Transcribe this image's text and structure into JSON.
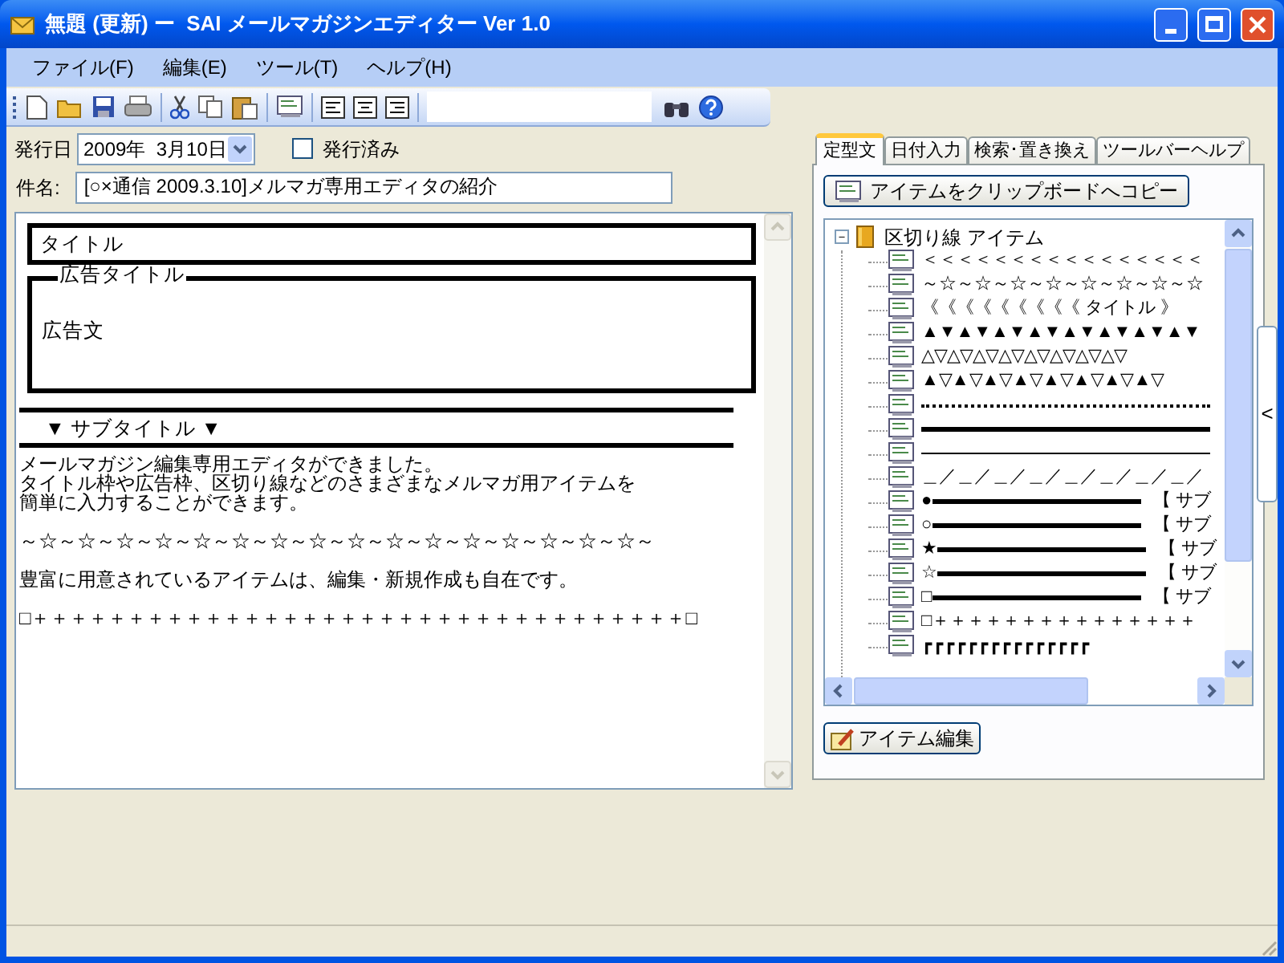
{
  "window": {
    "title": "無題 (更新) ー  SAI メールマガジンエディター Ver 1.0"
  },
  "menu": [
    "ファイル(F)",
    "編集(E)",
    "ツール(T)",
    "ヘルプ(H)"
  ],
  "form": {
    "date_label": "発行日",
    "date": "2009年  3月10日",
    "published": {
      "label": "発行済み",
      "checked": false
    },
    "subject_label": "件名:",
    "subject": "[○×通信 2009.3.10]メルマガ専用エディタの紹介"
  },
  "editor": [
    {
      "kind": "title_box",
      "text": "タイトル"
    },
    {
      "kind": "ad_box",
      "title": "広告タイトル",
      "body": "広告文"
    },
    {
      "kind": "subtitle",
      "text": "▼ サブタイトル ▼"
    },
    {
      "kind": "paragraph",
      "lines": [
        "メールマガジン編集専用エディタができました。",
        "タイトル枠や広告枠、区切り線などのさまざまなメルマガ用アイテムを",
        "簡単に入力することができます。"
      ]
    },
    {
      "kind": "paragraph",
      "lines": [
        "～☆～☆～☆～☆～☆～☆～☆～☆～☆～☆～☆～☆～☆～☆～☆～☆～"
      ]
    },
    {
      "kind": "paragraph",
      "lines": [
        "豊富に用意されているアイテムは、編集・新規作成も自在です。"
      ]
    },
    {
      "kind": "paragraph",
      "lines": [
        "□＋＋＋＋＋＋＋＋＋＋＋＋＋＋＋＋＋＋＋＋＋＋＋＋＋＋＋＋＋＋＋＋＋＋□"
      ]
    }
  ],
  "tabs": [
    {
      "label": "定型文",
      "selected": true
    },
    {
      "label": "日付入力",
      "selected": false
    },
    {
      "label": "検索･置き換え",
      "selected": false
    },
    {
      "label": "ツールバーヘルプ",
      "selected": false
    }
  ],
  "copy_button": "アイテムをクリップボードへコピー",
  "tree": {
    "label": "区切り線 アイテム",
    "expanded": true,
    "expander": "－",
    "children": [
      {
        "kind": "text",
        "text": "＜＜＜＜＜＜＜＜＜＜＜＜＜＜＜＜"
      },
      {
        "kind": "text",
        "text": "～☆～☆～☆～☆～☆～☆～☆～☆"
      },
      {
        "kind": "text",
        "text": "《《《《《《《《《 タイトル 》"
      },
      {
        "kind": "text",
        "text": "▲▼▲▼▲▼▲▼▲▼▲▼▲▼▲▼"
      },
      {
        "kind": "text",
        "text": "△▽△▽△▽△▽△▽△▽△▽△▽"
      },
      {
        "kind": "text",
        "text": "▲▽▲▽▲▽▲▽▲▽▲▽▲▽▲▽"
      },
      {
        "kind": "dotted_rule"
      },
      {
        "kind": "thick_rule"
      },
      {
        "kind": "thin_rule"
      },
      {
        "kind": "text",
        "text": "＿／＿／＿／＿／＿／＿／＿／＿／"
      },
      {
        "kind": "marker",
        "mark": "●",
        "suffix": "【 サブ"
      },
      {
        "kind": "marker",
        "mark": "○",
        "suffix": "【 サブ"
      },
      {
        "kind": "marker",
        "mark": "★",
        "suffix": "【 サブ"
      },
      {
        "kind": "marker",
        "mark": "☆",
        "suffix": "【 サブ"
      },
      {
        "kind": "marker",
        "mark": "□",
        "suffix": "【 サブ"
      },
      {
        "kind": "text",
        "text": "□＋＋＋＋＋＋＋＋＋＋＋＋＋＋＋"
      },
      {
        "kind": "text",
        "text": "┏┏┏┏┏┏┏┏┏┏┏┏┏┏┏"
      }
    ]
  },
  "edit_button": "アイテム編集",
  "side_handle": "<"
}
